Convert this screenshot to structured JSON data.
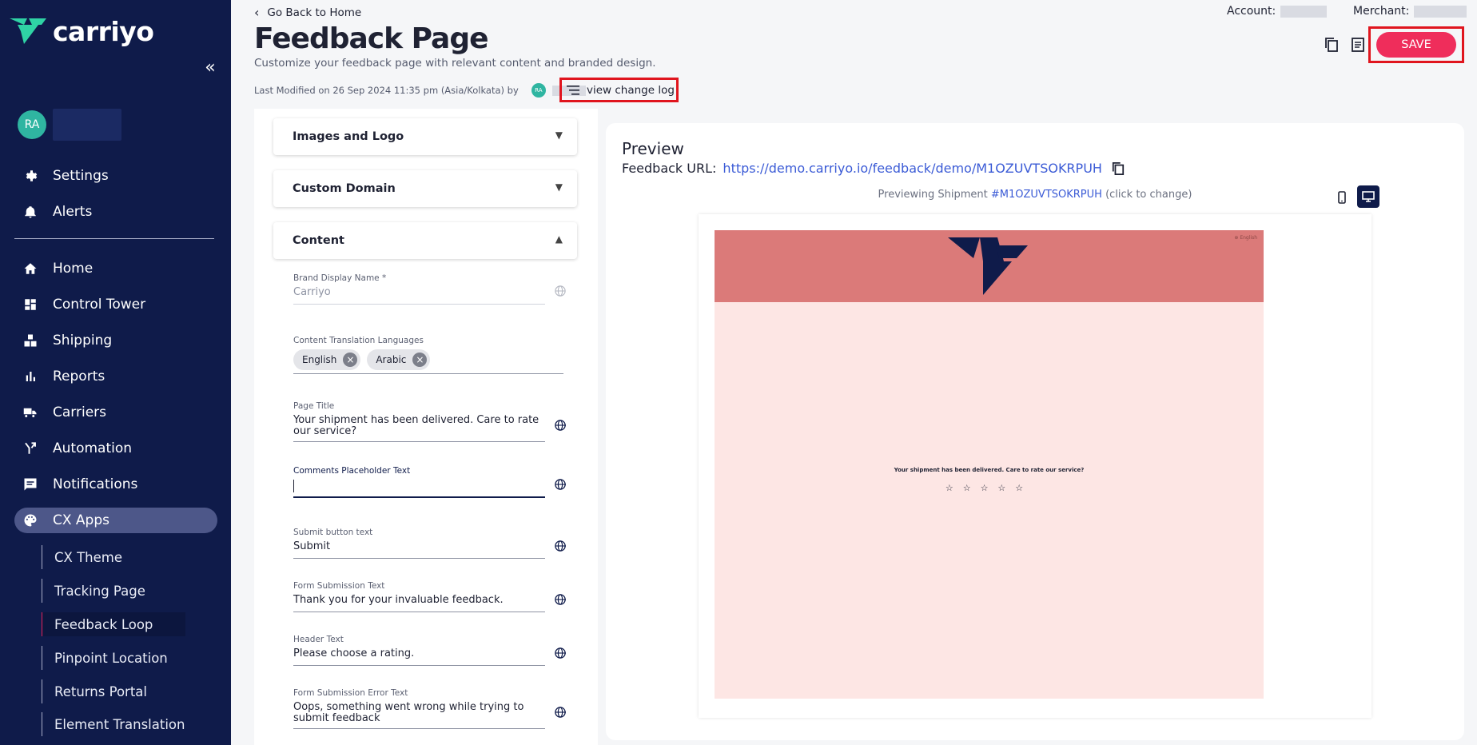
{
  "app": {
    "logo_text": "carriyo"
  },
  "user": {
    "initials": "RA"
  },
  "sidebar": {
    "top_items": [
      {
        "label": "Settings",
        "icon": "gear-icon"
      },
      {
        "label": "Alerts",
        "icon": "bell-icon"
      }
    ],
    "main_items": [
      {
        "label": "Home",
        "icon": "home-icon"
      },
      {
        "label": "Control Tower",
        "icon": "dashboard-icon"
      },
      {
        "label": "Shipping",
        "icon": "boxes-icon"
      },
      {
        "label": "Reports",
        "icon": "bar-chart-icon"
      },
      {
        "label": "Carriers",
        "icon": "truck-icon"
      },
      {
        "label": "Automation",
        "icon": "automation-icon"
      },
      {
        "label": "Notifications",
        "icon": "message-icon"
      },
      {
        "label": "CX Apps",
        "icon": "palette-icon",
        "active": true
      }
    ],
    "sub_items": [
      {
        "label": "CX Theme"
      },
      {
        "label": "Tracking Page"
      },
      {
        "label": "Feedback Loop",
        "active": true
      },
      {
        "label": "Pinpoint Location"
      },
      {
        "label": "Returns Portal"
      },
      {
        "label": "Element Translation"
      }
    ]
  },
  "header": {
    "back_label": "Go Back to Home",
    "title": "Feedback Page",
    "subtitle": "Customize your feedback page with relevant content and branded design.",
    "last_modified": "Last Modified on 26 Sep 2024 11:35 pm (Asia/Kolkata) by",
    "modifier_initials": "RA",
    "change_log_label": "view change log",
    "account_label": "Account:",
    "merchant_label": "Merchant:",
    "save_label": "SAVE"
  },
  "form": {
    "accordions": [
      {
        "label": "Images and Logo",
        "expanded": false
      },
      {
        "label": "Custom Domain",
        "expanded": false
      },
      {
        "label": "Content",
        "expanded": true
      }
    ],
    "brand_display_name": {
      "label": "Brand Display Name *",
      "value": "Carriyo"
    },
    "languages": {
      "label": "Content Translation Languages",
      "chips": [
        "English",
        "Arabic"
      ]
    },
    "page_title": {
      "label": "Page Title",
      "value": "Your shipment has been delivered. Care to rate our service?"
    },
    "comments_placeholder": {
      "label": "Comments Placeholder Text",
      "value": ""
    },
    "submit_button": {
      "label": "Submit button text",
      "value": "Submit"
    },
    "submission_text": {
      "label": "Form Submission Text",
      "value": "Thank you for your invaluable feedback."
    },
    "header_text": {
      "label": "Header Text",
      "value": "Please choose a rating."
    },
    "error_text": {
      "label": "Form Submission Error Text",
      "value": "Oops, something went wrong while trying to submit feedback"
    }
  },
  "preview": {
    "title": "Preview",
    "url_label": "Feedback URL:",
    "url": "https://demo.carriyo.io/feedback/demo/M1OZUVTSOKRPUH",
    "shipment_prefix": "Previewing Shipment",
    "shipment_id": "#M1OZUVTSOKRPUH",
    "shipment_suffix": "(click to change)",
    "page_lang": "English",
    "question": "Your shipment has been delivered. Care to rate our service?",
    "stars": "☆☆☆☆☆",
    "colors": {
      "header_bg": "#db7a79",
      "body_bg": "#fde6e4",
      "brand_navy": "#0f1b4a",
      "accent": "#ef2d5b"
    }
  }
}
